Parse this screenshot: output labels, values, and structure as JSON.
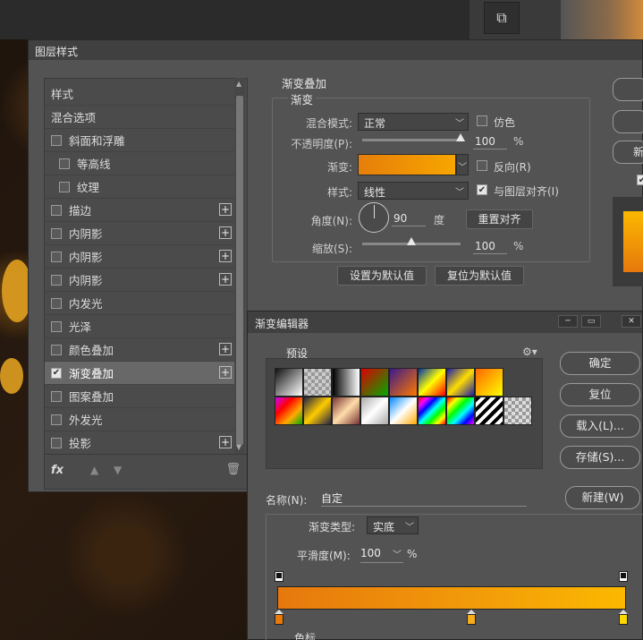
{
  "layer_style": {
    "title": "图层样式",
    "list_items": [
      {
        "label": "样式",
        "checkbox": false,
        "checked": false,
        "plus": false,
        "selected": false
      },
      {
        "label": "混合选项",
        "checkbox": false,
        "checked": false,
        "plus": false,
        "selected": false
      },
      {
        "label": "斜面和浮雕",
        "checkbox": true,
        "checked": false,
        "plus": false,
        "selected": false
      },
      {
        "label": "等高线",
        "checkbox": true,
        "checked": false,
        "plus": false,
        "selected": false,
        "indent": true
      },
      {
        "label": "纹理",
        "checkbox": true,
        "checked": false,
        "plus": false,
        "selected": false,
        "indent": true
      },
      {
        "label": "描边",
        "checkbox": true,
        "checked": false,
        "plus": true,
        "selected": false
      },
      {
        "label": "内阴影",
        "checkbox": true,
        "checked": false,
        "plus": true,
        "selected": false
      },
      {
        "label": "内阴影",
        "checkbox": true,
        "checked": false,
        "plus": true,
        "selected": false
      },
      {
        "label": "内阴影",
        "checkbox": true,
        "checked": false,
        "plus": true,
        "selected": false
      },
      {
        "label": "内发光",
        "checkbox": true,
        "checked": false,
        "plus": false,
        "selected": false
      },
      {
        "label": "光泽",
        "checkbox": true,
        "checked": false,
        "plus": false,
        "selected": false
      },
      {
        "label": "颜色叠加",
        "checkbox": true,
        "checked": false,
        "plus": true,
        "selected": false
      },
      {
        "label": "渐变叠加",
        "checkbox": true,
        "checked": true,
        "plus": true,
        "selected": true
      },
      {
        "label": "图案叠加",
        "checkbox": true,
        "checked": false,
        "plus": false,
        "selected": false
      },
      {
        "label": "外发光",
        "checkbox": true,
        "checked": false,
        "plus": false,
        "selected": false
      },
      {
        "label": "投影",
        "checkbox": true,
        "checked": false,
        "plus": true,
        "selected": false
      }
    ],
    "footer_fx": "fx",
    "gradient_overlay": {
      "group_title": "渐变叠加",
      "sub_title": "渐变",
      "blend_mode_label": "混合模式:",
      "blend_mode_value": "正常",
      "dither_label": "仿色",
      "opacity_label": "不透明度(P):",
      "opacity_value": "100",
      "opacity_unit": "%",
      "opacity_fraction": 1.0,
      "gradient_label": "渐变:",
      "reverse_label": "反向(R)",
      "style_label": "样式:",
      "style_value": "线性",
      "align_label": "与图层对齐(I)",
      "angle_label": "角度(N):",
      "angle_value": "90",
      "angle_unit": "度",
      "reset_align_label": "重置对齐",
      "scale_label": "缩放(S):",
      "scale_value": "100",
      "scale_unit": "%",
      "scale_fraction": 0.5,
      "set_default_label": "设置为默认值",
      "reset_default_label": "复位为默认值"
    },
    "right_buttons": [
      "",
      "",
      "新"
    ]
  },
  "gradient_editor": {
    "title": "渐变编辑器",
    "presets_label": "预设",
    "ok_label": "确定",
    "reset_label": "复位",
    "load_label": "载入(L)...",
    "save_label": "存储(S)...",
    "name_label": "名称(N):",
    "name_value": "自定",
    "new_label": "新建(W)",
    "type_label": "渐变类型:",
    "type_value": "实底",
    "smooth_label": "平滑度(M):",
    "smooth_value": "100",
    "smooth_unit": "%",
    "bottom_label": "色标",
    "colors": {
      "start": "#e6780c",
      "end": "#fbb800"
    }
  }
}
